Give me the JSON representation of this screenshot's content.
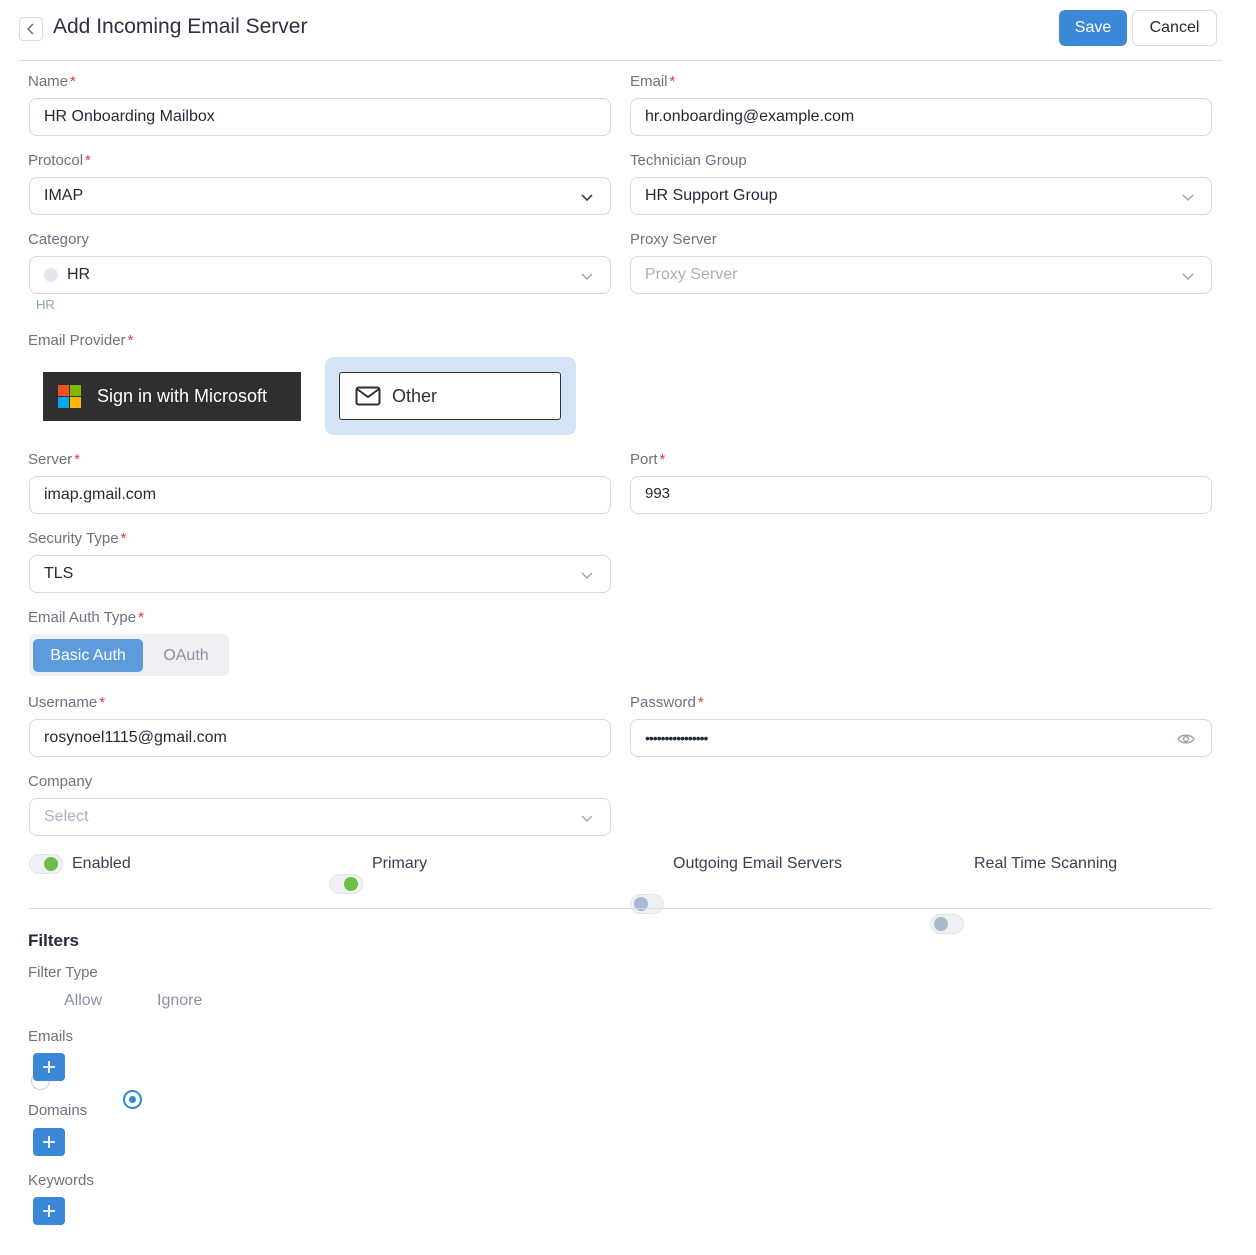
{
  "header": {
    "title": "Add Incoming Email Server",
    "save_label": "Save",
    "cancel_label": "Cancel"
  },
  "form": {
    "name": {
      "label": "Name",
      "value": "HR Onboarding Mailbox"
    },
    "email": {
      "label": "Email",
      "value": "hr.onboarding@example.com"
    },
    "protocol": {
      "label": "Protocol",
      "value": "IMAP"
    },
    "technician_group": {
      "label": "Technician Group",
      "value": "HR Support Group"
    },
    "category": {
      "label": "Category",
      "value": "HR",
      "tag": "HR"
    },
    "proxy_server": {
      "label": "Proxy Server",
      "placeholder": "Proxy Server"
    },
    "email_provider": {
      "label": "Email Provider",
      "microsoft_label": "Sign in with Microsoft",
      "other_label": "Other"
    },
    "server": {
      "label": "Server",
      "value": "imap.gmail.com"
    },
    "port": {
      "label": "Port",
      "value": "993"
    },
    "security_type": {
      "label": "Security Type",
      "value": "TLS"
    },
    "email_auth_type": {
      "label": "Email Auth Type",
      "options": [
        "Basic Auth",
        "OAuth"
      ],
      "selected": "Basic Auth"
    },
    "username": {
      "label": "Username",
      "value": "rosynoel1115@gmail.com"
    },
    "password": {
      "label": "Password",
      "value": "••••••••••••••••"
    },
    "company": {
      "label": "Company",
      "placeholder": "Select"
    }
  },
  "switches": [
    {
      "label": "Enabled",
      "on": true
    },
    {
      "label": "Primary",
      "on": true
    },
    {
      "label": "Outgoing Email Servers",
      "on": false
    },
    {
      "label": "Real Time Scanning",
      "on": false
    }
  ],
  "filters": {
    "title": "Filters",
    "filter_type_label": "Filter Type",
    "options": [
      "Allow",
      "Ignore"
    ],
    "selected": "Ignore",
    "emails_label": "Emails",
    "domains_label": "Domains",
    "keywords_label": "Keywords"
  },
  "colors": {
    "primary": "#3b87d8",
    "toggle_on": "#6cc04a",
    "required": "#e03b3b",
    "provider_selected_bg": "#d4e4f5"
  }
}
